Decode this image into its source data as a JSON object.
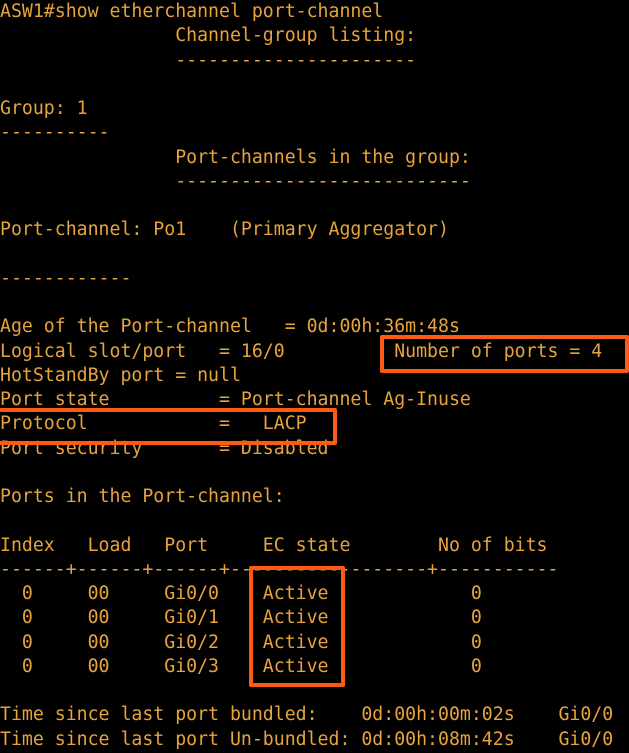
{
  "terminal": {
    "lines": [
      "ASW1#show etherchannel port-channel",
      "                Channel-group listing:",
      "                ----------------------",
      "",
      "Group: 1",
      "----------",
      "                Port-channels in the group:",
      "                ---------------------------",
      "",
      "Port-channel: Po1    (Primary Aggregator)",
      "",
      "------------",
      "",
      "Age of the Port-channel   = 0d:00h:36m:48s",
      "Logical slot/port   = 16/0          Number of ports = 4",
      "HotStandBy port = null",
      "Port state          = Port-channel Ag-Inuse",
      "Protocol            =   LACP",
      "Port security       = Disabled",
      "",
      "Ports in the Port-channel:",
      "",
      "Index   Load   Port     EC state        No of bits",
      "------+------+------+------------------+-----------",
      "  0     00     Gi0/0    Active             0",
      "  0     00     Gi0/1    Active             0",
      "  0     00     Gi0/2    Active             0",
      "  0     00     Gi0/3    Active             0",
      "",
      "Time since last port bundled:    0d:00h:00m:02s    Gi0/0",
      "Time since last port Un-bundled: 0d:00h:08m:42s    Gi0/0"
    ]
  },
  "colors": {
    "background": "#000000",
    "text": "#e7a33c",
    "highlight": "#ff5a14"
  }
}
